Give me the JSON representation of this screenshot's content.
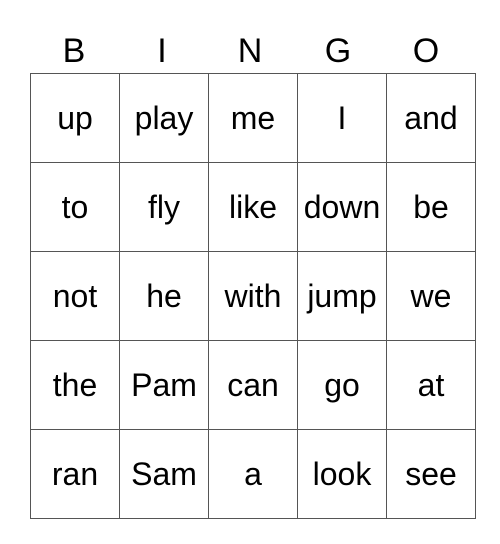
{
  "header": [
    "B",
    "I",
    "N",
    "G",
    "O"
  ],
  "rows": [
    [
      "up",
      "play",
      "me",
      "I",
      "and"
    ],
    [
      "to",
      "fly",
      "like",
      "down",
      "be"
    ],
    [
      "not",
      "he",
      "with",
      "jump",
      "we"
    ],
    [
      "the",
      "Pam",
      "can",
      "go",
      "at"
    ],
    [
      "ran",
      "Sam",
      "a",
      "look",
      "see"
    ]
  ]
}
